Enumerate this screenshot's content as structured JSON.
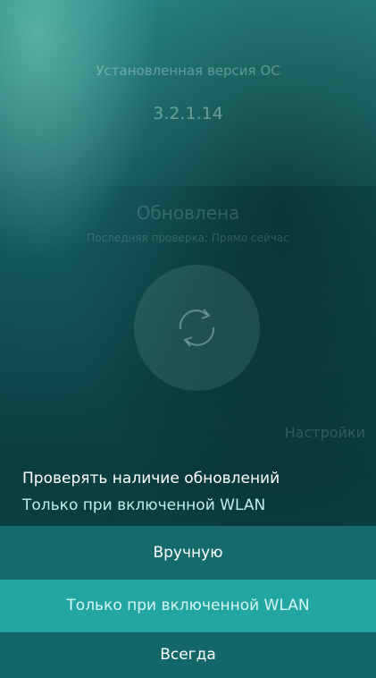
{
  "os": {
    "label": "Установленная версия ОС",
    "version": "3.2.1.14"
  },
  "status": {
    "title": "Обновлена",
    "last_check": "Последняя проверка: Прямо сейчас"
  },
  "settings_link": "Настройки",
  "check_updates": {
    "label": "Проверять наличие обновлений",
    "value": "Только при включенной WLAN"
  },
  "menu": {
    "items": [
      {
        "label": "Вручную"
      },
      {
        "label": "Только при включенной WLAN",
        "selected": true
      },
      {
        "label": "Всегда"
      }
    ]
  },
  "colors": {
    "menu_bg": "#156b6b",
    "menu_selected_bg": "#23a5a2"
  },
  "icons": {
    "refresh": "refresh-icon"
  }
}
